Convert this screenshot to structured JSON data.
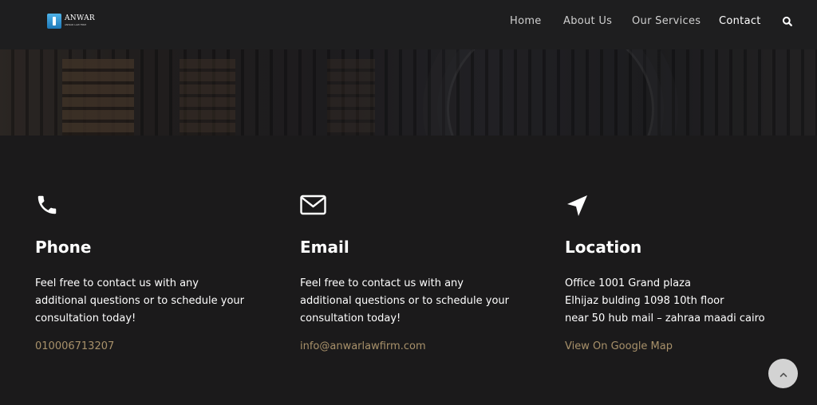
{
  "brand": {
    "name": "ANWAR",
    "subtitle": "ANWAR LAW FIRM"
  },
  "nav": {
    "items": [
      {
        "label": "Home"
      },
      {
        "label": "About Us"
      },
      {
        "label": "Our Services"
      },
      {
        "label": "Contact",
        "active": true
      }
    ],
    "search_icon": "search-icon"
  },
  "contact": {
    "phone": {
      "icon": "phone-icon",
      "title": "Phone",
      "lines": [
        "Feel free to contact us with any",
        "additional questions or to schedule your",
        "consultation today!"
      ],
      "link": "010006713207"
    },
    "email": {
      "icon": "envelope-icon",
      "title": "Email",
      "lines": [
        "Feel free to contact us with any",
        "additional questions or to schedule your",
        "consultation today!"
      ],
      "link": "info@anwarlawfirm.com"
    },
    "location": {
      "icon": "location-arrow-icon",
      "title": "Location",
      "lines": [
        "Office 1001 Grand plaza",
        "Elhijaz bulding 1098 10th floor",
        "near 50 hub mail – zahraa maadi cairo"
      ],
      "link": "View On Google Map"
    }
  },
  "colors": {
    "background": "#1b1a1b",
    "navbar": "#1e1e1f",
    "accent_link": "#a8916a",
    "scroll_button": "#d3d3d3"
  },
  "scroll_top_icon": "chevron-up-icon"
}
